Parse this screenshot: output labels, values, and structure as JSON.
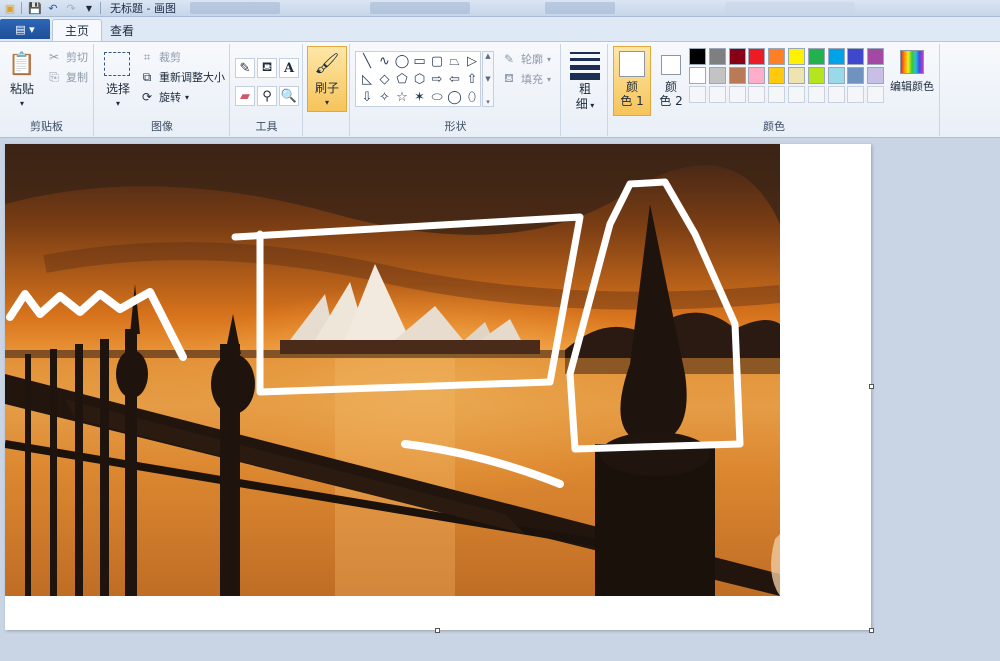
{
  "window": {
    "title": "无标题 - 画图"
  },
  "tabs": [
    {
      "label": "主页",
      "active": true
    },
    {
      "label": "查看",
      "active": false
    }
  ],
  "file_button": {
    "icon": "file-menu-icon"
  },
  "clipboard": {
    "paste_label": "粘贴",
    "cut_label": "剪切",
    "copy_label": "复制",
    "group_label": "剪贴板"
  },
  "image": {
    "select_label": "选择",
    "crop_label": "裁剪",
    "resize_label": "重新调整大小",
    "rotate_label": "旋转",
    "group_label": "图像"
  },
  "tools": {
    "group_label": "工具",
    "items": [
      "pencil-icon",
      "fill-icon",
      "text-icon",
      "eraser-icon",
      "color-picker-icon",
      "magnifier-icon"
    ]
  },
  "brush": {
    "label": "刷子"
  },
  "shapes": {
    "outline_label": "轮廓",
    "fill_label": "填充",
    "group_label": "形状",
    "glyphs": [
      "╲",
      "∿",
      "◯",
      "▭",
      "▢",
      "⏢",
      "▷",
      "◺",
      "◇",
      "⬠",
      "⬡",
      "⇨",
      "⇦",
      "⇧",
      "⇩",
      "✧",
      "☆",
      "✶",
      "⬭",
      "◯",
      "⬯"
    ]
  },
  "size": {
    "label_top": "粗",
    "label_bottom": "细"
  },
  "colors": {
    "color1_top": "颜",
    "color1_bottom": "色 1",
    "color2_top": "颜",
    "color2_bottom": "色 2",
    "edit_label": "编辑颜色",
    "group_label": "颜色",
    "palette_row1": [
      "#000000",
      "#7f7f7f",
      "#880015",
      "#ed1c24",
      "#ff7f27",
      "#fff200",
      "#22b14c",
      "#00a2e8",
      "#3f48cc",
      "#a349a4"
    ],
    "palette_row2": [
      "#ffffff",
      "#c3c3c3",
      "#b97a57",
      "#ffaec9",
      "#ffc90e",
      "#efe4b0",
      "#b5e61d",
      "#99d9ea",
      "#7092be",
      "#c8bfe7"
    ],
    "custom_count": 10
  }
}
